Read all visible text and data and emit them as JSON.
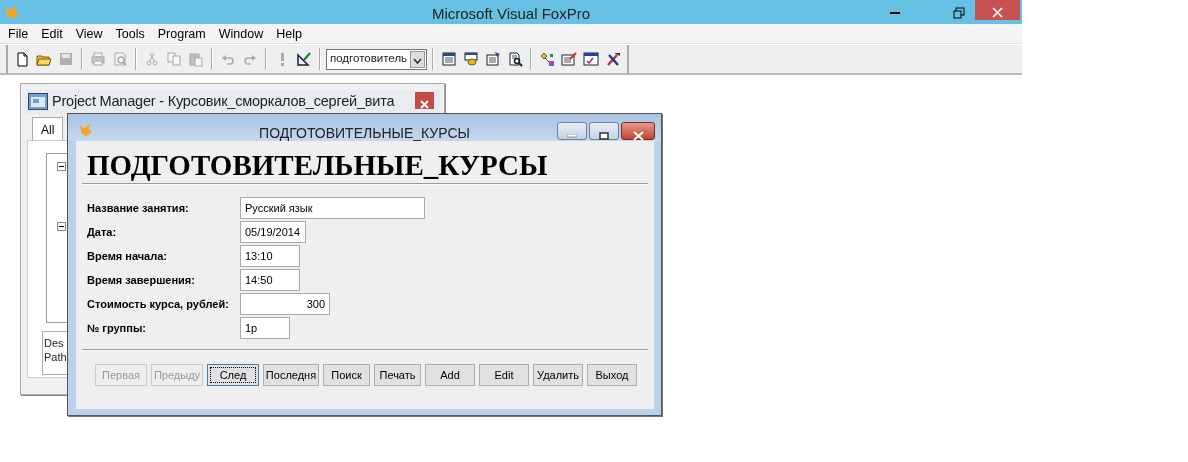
{
  "app": {
    "title": "Microsoft Visual FoxPro"
  },
  "menu": [
    "File",
    "Edit",
    "View",
    "Tools",
    "Program",
    "Window",
    "Help"
  ],
  "toolbar": [
    {
      "kind": "page",
      "disabled": false
    },
    {
      "kind": "folder",
      "disabled": false
    },
    {
      "kind": "disk",
      "disabled": true
    },
    {
      "kind": "separator"
    },
    {
      "kind": "printer",
      "disabled": true
    },
    {
      "kind": "preview",
      "disabled": true
    },
    {
      "kind": "separator"
    },
    {
      "kind": "scissors",
      "disabled": true
    },
    {
      "kind": "copy",
      "disabled": true
    },
    {
      "kind": "paste",
      "disabled": true
    },
    {
      "kind": "separator"
    },
    {
      "kind": "undo",
      "disabled": true
    },
    {
      "kind": "redo",
      "disabled": true
    },
    {
      "kind": "separator"
    },
    {
      "kind": "exclaim",
      "disabled": true
    },
    {
      "kind": "wizard",
      "disabled": false
    },
    {
      "kind": "separator"
    },
    {
      "kind": "combo",
      "value": "подготовитель"
    },
    {
      "kind": "separator"
    },
    {
      "kind": "grid",
      "disabled": false
    },
    {
      "kind": "database",
      "disabled": false
    },
    {
      "kind": "properties",
      "disabled": false
    },
    {
      "kind": "inspect",
      "disabled": false
    },
    {
      "kind": "separator"
    },
    {
      "kind": "diagram",
      "disabled": false
    },
    {
      "kind": "formedit",
      "disabled": false
    },
    {
      "kind": "form",
      "disabled": false
    },
    {
      "kind": "tools",
      "disabled": false
    }
  ],
  "project_manager": {
    "title": "Project Manager - Курсовик_сморкалов_сергей_вита",
    "tabs": [
      {
        "label": "All",
        "selected": true
      }
    ],
    "info_lines": [
      "Des",
      "Path"
    ]
  },
  "form_window": {
    "title": "ПОДГОТОВИТЕЛЬНЫЕ_КУРСЫ",
    "heading": "ПОДГОТОВИТЕЛЬНЫЕ_КУРСЫ",
    "fields": [
      {
        "label": "Название занятия:",
        "value": "Русский язык"
      },
      {
        "label": "Дата:",
        "value": "05/19/2014"
      },
      {
        "label": "Время начала:",
        "value": "13:10"
      },
      {
        "label": "Время завершения:",
        "value": "14:50"
      },
      {
        "label": "Стоимость курса, рублей:",
        "value": "300"
      },
      {
        "label": "№ группы:",
        "value": "1р"
      }
    ],
    "buttons": [
      {
        "label": "Первая",
        "disabled": true,
        "focused": false
      },
      {
        "label": "Предыду",
        "disabled": true,
        "focused": false
      },
      {
        "label": "След",
        "disabled": false,
        "focused": true
      },
      {
        "label": "Последня",
        "disabled": false,
        "focused": false
      },
      {
        "label": "Поиск",
        "disabled": false,
        "focused": false
      },
      {
        "label": "Печать",
        "disabled": false,
        "focused": false
      },
      {
        "label": "Add",
        "disabled": false,
        "focused": false
      },
      {
        "label": "Edit",
        "disabled": false,
        "focused": false
      },
      {
        "label": "Удалить",
        "disabled": false,
        "focused": false
      },
      {
        "label": "Выход",
        "disabled": false,
        "focused": false
      }
    ]
  }
}
